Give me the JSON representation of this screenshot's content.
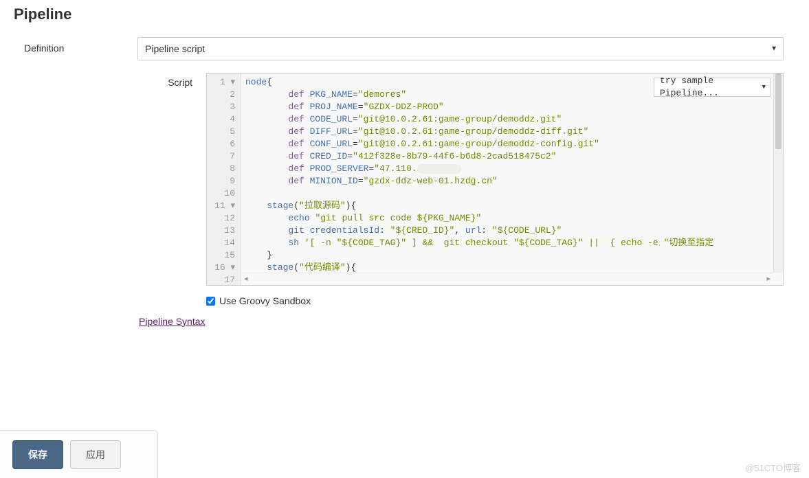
{
  "section_title": "Pipeline",
  "labels": {
    "definition": "Definition",
    "script": "Script"
  },
  "definition_select": "Pipeline script",
  "sample_select_label": "try sample Pipeline...",
  "gutter_numbers": [
    "1",
    "2",
    "3",
    "4",
    "5",
    "6",
    "7",
    "8",
    "9",
    "10",
    "11",
    "12",
    "13",
    "14",
    "15",
    "16",
    "17"
  ],
  "code": {
    "lines": [
      {
        "indent": "",
        "kw": "",
        "var": "node",
        "punct": "{"
      },
      {
        "indent": "        ",
        "kw": "def",
        "var": " PKG_NAME",
        "eq": "=",
        "str": "\"demores\""
      },
      {
        "indent": "        ",
        "kw": "def",
        "var": " PROJ_NAME",
        "eq": "=",
        "str": "\"GZDX-DDZ-PROD\""
      },
      {
        "indent": "        ",
        "kw": "def",
        "var": " CODE_URL",
        "eq": "=",
        "str": "\"git@10.0.2.61:game-group/demoddz.git\""
      },
      {
        "indent": "        ",
        "kw": "def",
        "var": " DIFF_URL",
        "eq": "=",
        "str": "\"git@10.0.2.61:game-group/demoddz-diff.git\""
      },
      {
        "indent": "        ",
        "kw": "def",
        "var": " CONF_URL",
        "eq": "=",
        "str": "\"git@10.0.2.61:game-group/demoddz-config.git\""
      },
      {
        "indent": "        ",
        "kw": "def",
        "var": " CRED_ID",
        "eq": "=",
        "str": "\"412f328e-8b79-44f6-b6d8-2cad518475c2\""
      },
      {
        "indent": "        ",
        "kw": "def",
        "var": " PROD_SERVER",
        "eq": "=",
        "str": "\"47.110.",
        "smudge": true
      },
      {
        "indent": "        ",
        "kw": "def",
        "var": " MINION_ID",
        "eq": "=",
        "str": "\"gzdx-ddz-web-01.hzdg.cn\""
      },
      {
        "empty": true
      },
      {
        "indent": "    ",
        "var": "stage",
        "punct": "(",
        "str": "\"拉取源码\"",
        "tail": "){"
      },
      {
        "indent": "        ",
        "var": "echo ",
        "str": "\"git pull src code ${PKG_NAME}\""
      },
      {
        "indent": "        ",
        "var": "git credentialsId",
        "punct": ": ",
        "str": "\"${CRED_ID}\"",
        "mid": ", ",
        "var2": "url",
        "punct2": ": ",
        "str2": "\"${CODE_URL}\""
      },
      {
        "indent": "        ",
        "var": "sh ",
        "str": "'[ -n \"${CODE_TAG}\" ] &&  git checkout \"${CODE_TAG}\" ||  { echo -e \"切换至指定"
      },
      {
        "indent": "    ",
        "punct": "}"
      },
      {
        "indent": "    ",
        "var": "stage",
        "punct": "(",
        "str": "\"代码编译\"",
        "tail": "){"
      }
    ]
  },
  "sandbox": {
    "checked": true,
    "label": "Use Groovy Sandbox"
  },
  "syntax_link": "Pipeline Syntax",
  "buttons": {
    "save": "保存",
    "apply": "应用"
  },
  "watermark": "@51CTO博客"
}
